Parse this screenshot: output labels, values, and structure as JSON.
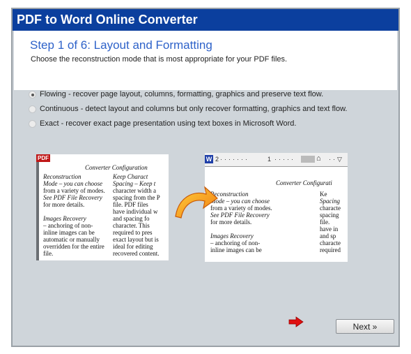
{
  "app": {
    "title": "PDF to Word Online Converter"
  },
  "header": {
    "step_title": "Step 1 of 6: Layout and Formatting",
    "description": "Choose the reconstruction mode that is most appropriate for your PDF files."
  },
  "options": [
    {
      "label": "Flowing - recover page layout, columns, formatting, graphics and preserve text flow.",
      "selected": true
    },
    {
      "label": "Continuous - detect layout and columns but only recover formatting, graphics and text flow.",
      "selected": false
    },
    {
      "label": "Exact - recover exact page presentation using text boxes in Microsoft Word.",
      "selected": false
    }
  ],
  "preview": {
    "pdf_badge": "PDF",
    "word_badge": "W",
    "ruler": {
      "left_num": "2",
      "mid_num": "1"
    },
    "left_doc": {
      "title": "Converter Configuration",
      "col1": [
        "Reconstruction",
        "Mode – you can choose",
        "from a variety of modes.",
        "See PDF File Recovery",
        "for more details.",
        "",
        "Images Recovery",
        "– anchoring of non-",
        "inline images can be",
        "automatic or manually",
        "overridden for the entire",
        "file."
      ],
      "col2": [
        "Keep Charact",
        "Spacing – Keep t",
        "character width a",
        "spacing from the P",
        "file. PDF files",
        "have individual w",
        "and spacing fo",
        "character. This",
        "required to pres",
        "exact layout but is",
        "ideal for editing",
        "recovered content."
      ]
    },
    "right_doc": {
      "title": "Converter Configurati",
      "col1": [
        "Reconstruction",
        "Mode – you can choose",
        "from a variety of modes.",
        "See PDF File Recovery",
        "for more details.",
        "",
        "Images Recovery",
        "– anchoring of non-",
        "inline images can be"
      ],
      "col2": [
        "Ke",
        "Spacing",
        "characte",
        "spacing",
        "file.",
        "have in",
        "and sp",
        "characte",
        "required"
      ]
    }
  },
  "footer": {
    "next_label": "Next »"
  },
  "colors": {
    "title_bar": "#0b3f9e",
    "step_title": "#2e62c9",
    "arrow": "#f5a01a",
    "next_indicator": "#e01010"
  }
}
